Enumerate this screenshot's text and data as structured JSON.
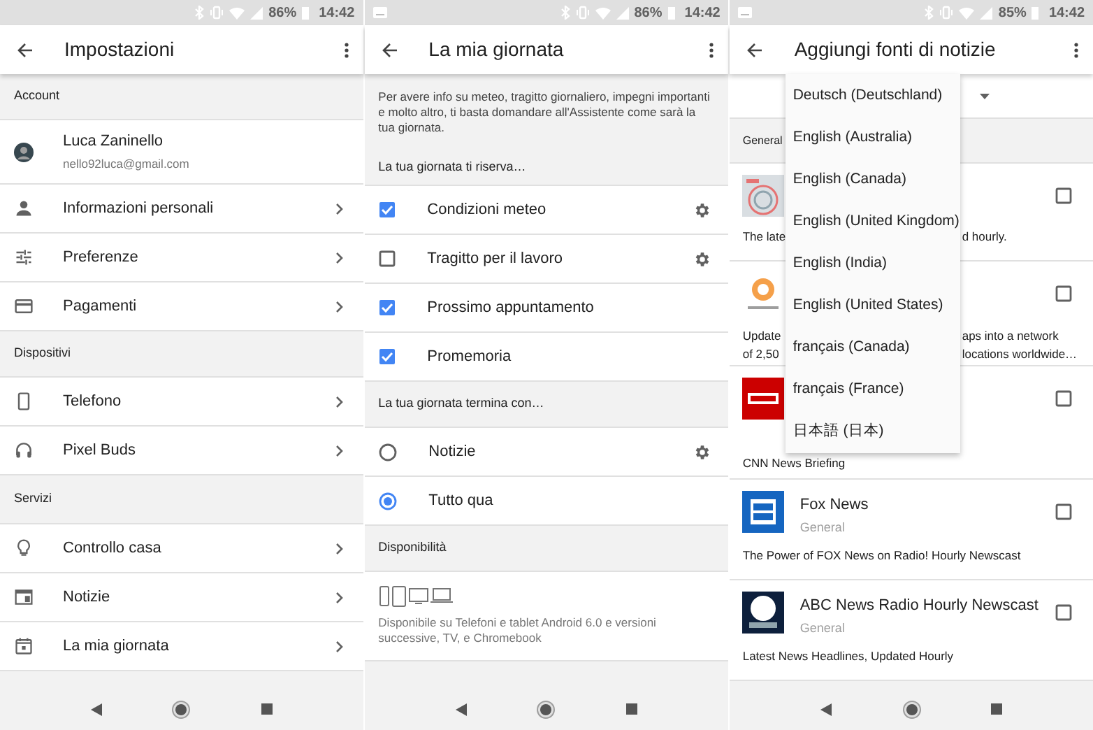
{
  "panels": [
    {
      "kind": "settings",
      "status_bar": {
        "battery": "86%",
        "time": "14:42"
      },
      "title": "Impostazioni",
      "sections": [
        {
          "header": "Account",
          "rows": [
            {
              "kind": "profile",
              "title": "Luca Zaninello",
              "subtitle": "nello92luca@gmail.com"
            },
            {
              "kind": "link",
              "label": "Informazioni personali"
            },
            {
              "kind": "link",
              "label": "Preferenze"
            },
            {
              "kind": "link",
              "label": "Pagamenti"
            }
          ]
        },
        {
          "header": "Dispositivi",
          "rows": [
            {
              "kind": "link",
              "label": "Telefono"
            },
            {
              "kind": "link",
              "label": "Pixel Buds"
            }
          ]
        },
        {
          "header": "Servizi",
          "rows": [
            {
              "kind": "link",
              "label": "Controllo casa"
            },
            {
              "kind": "link",
              "label": "Notizie"
            },
            {
              "kind": "link",
              "label": "La mia giornata"
            }
          ]
        }
      ]
    },
    {
      "kind": "settings",
      "status_bar": {
        "battery": "86%",
        "time": "14:42"
      },
      "title": "La mia giornata",
      "intro": "Per avere info su meteo, tragitto giornaliero, impegni importanti e molto altro, ti basta domandare all'Assistente come sarà la tua giornata.",
      "sections": [
        {
          "header": "La tua giornata ti riserva…",
          "rows": [
            {
              "kind": "checkbox",
              "label": "Condizioni meteo",
              "checked": true,
              "settings": true
            },
            {
              "kind": "checkbox",
              "label": "Tragitto per il lavoro",
              "checked": false,
              "settings": true
            },
            {
              "kind": "checkbox",
              "label": "Prossimo appuntamento",
              "checked": true,
              "settings": false
            },
            {
              "kind": "checkbox",
              "label": "Promemoria",
              "checked": true,
              "settings": false
            }
          ]
        },
        {
          "header": "La tua giornata termina con…",
          "rows": [
            {
              "kind": "radio",
              "label": "Notizie",
              "selected": false,
              "settings": true
            },
            {
              "kind": "radio",
              "label": "Tutto qua",
              "selected": true,
              "settings": false
            }
          ]
        },
        {
          "header": "Disponibilità",
          "rows": [
            {
              "kind": "devices",
              "text": "Disponibile su Telefoni e tablet Android 6.0 e versioni successive, TV, e Chromebook"
            }
          ]
        }
      ]
    },
    {
      "kind": "sources",
      "status_bar": {
        "battery": "85%",
        "time": "14:42"
      },
      "title": "Aggiungi fonti di notizie",
      "header": "General",
      "menu": [
        "Deutsch (Deutschland)",
        "English (Australia)",
        "English (Canada)",
        "English (United Kingdom)",
        "English (India)",
        "English (United States)",
        "français (Canada)",
        "français (France)",
        "日本語 (日本)"
      ],
      "sources": [
        {
          "checked": false,
          "description": [
            [
              "The late",
              "d hourly."
            ]
          ]
        },
        {
          "checked": false,
          "description": [
            [
              "Update",
              "aps into a network"
            ],
            [
              "of 2,50",
              "locations worldwide…"
            ]
          ]
        },
        {
          "checked": false,
          "description": [
            [
              "CNN News Briefing"
            ]
          ]
        },
        {
          "title": "Fox News",
          "subtitle": "General",
          "checked": false,
          "description": [
            [
              "The Power of FOX News on Radio! Hourly Newscast"
            ]
          ]
        },
        {
          "title": "ABC News Radio Hourly Newscast",
          "subtitle": "General",
          "checked": false,
          "description": [
            [
              "Latest News Headlines, Updated Hourly"
            ]
          ]
        }
      ]
    }
  ]
}
